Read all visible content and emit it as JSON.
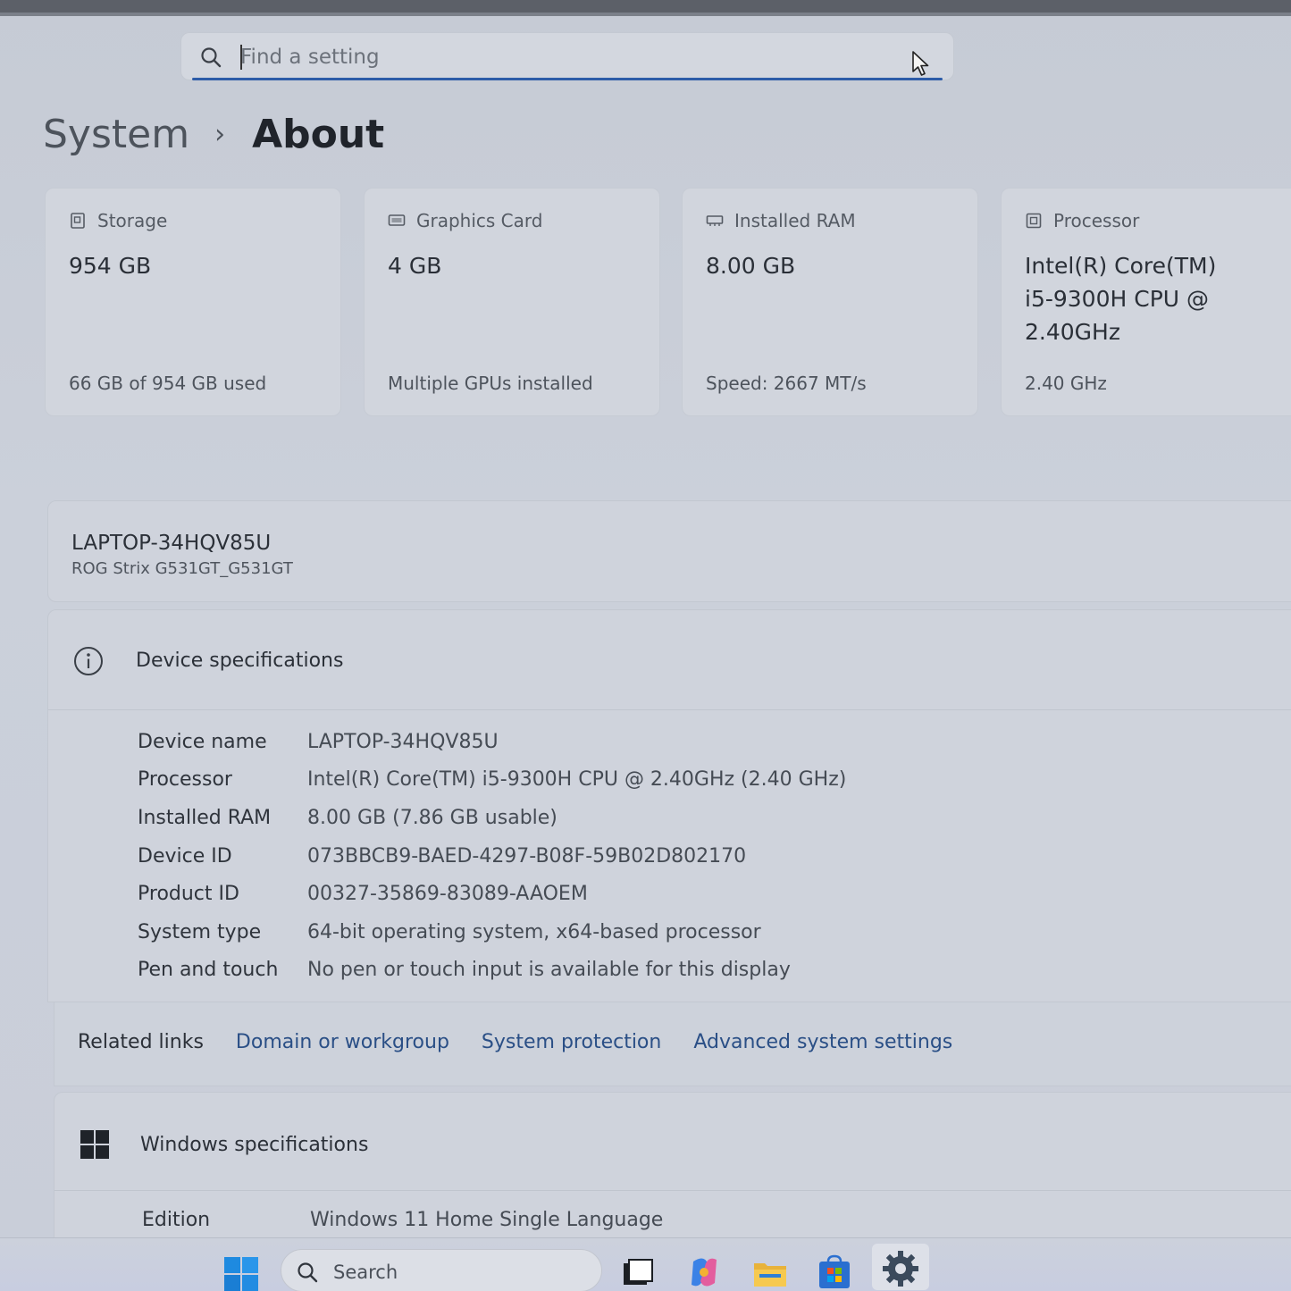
{
  "search": {
    "placeholder": "Find a setting"
  },
  "breadcrumb": {
    "parent": "System",
    "separator": "›",
    "current": "About"
  },
  "cards": [
    {
      "label": "Storage",
      "value": "954 GB",
      "sub": "66 GB of 954 GB used",
      "icon": "storage-icon"
    },
    {
      "label": "Graphics Card",
      "value": "4 GB",
      "sub": "Multiple GPUs installed",
      "icon": "graphics-card-icon"
    },
    {
      "label": "Installed RAM",
      "value": "8.00 GB",
      "sub": "Speed: 2667 MT/s",
      "icon": "ram-icon"
    },
    {
      "label": "Processor",
      "value": "Intel(R) Core(TM) i5-9300H CPU @ 2.40GHz",
      "sub": "2.40 GHz",
      "icon": "processor-icon"
    }
  ],
  "device": {
    "name": "LAPTOP-34HQV85U",
    "model": "ROG Strix G531GT_G531GT"
  },
  "device_specs": {
    "title": "Device specifications",
    "rows": [
      {
        "key": "Device name",
        "value": "LAPTOP-34HQV85U"
      },
      {
        "key": "Processor",
        "value": "Intel(R) Core(TM) i5-9300H CPU @ 2.40GHz (2.40 GHz)"
      },
      {
        "key": "Installed RAM",
        "value": "8.00 GB (7.86 GB usable)"
      },
      {
        "key": "Device ID",
        "value": "073BBCB9-BAED-4297-B08F-59B02D802170"
      },
      {
        "key": "Product ID",
        "value": "00327-35869-83089-AAOEM"
      },
      {
        "key": "System type",
        "value": "64-bit operating system, x64-based processor"
      },
      {
        "key": "Pen and touch",
        "value": "No pen or touch input is available for this display"
      }
    ]
  },
  "related_links": {
    "label": "Related links",
    "links": [
      "Domain or workgroup",
      "System protection",
      "Advanced system settings"
    ]
  },
  "windows_specs": {
    "title": "Windows specifications",
    "rows": [
      {
        "key": "Edition",
        "value": "Windows 11 Home Single Language"
      }
    ]
  },
  "taskbar": {
    "search_label": "Search",
    "apps": [
      "start-icon",
      "task-view-icon",
      "copilot-icon",
      "file-explorer-icon",
      "store-icon",
      "settings-icon"
    ]
  },
  "colors": {
    "accent": "#2d5ca8",
    "link": "#2a4f86"
  }
}
